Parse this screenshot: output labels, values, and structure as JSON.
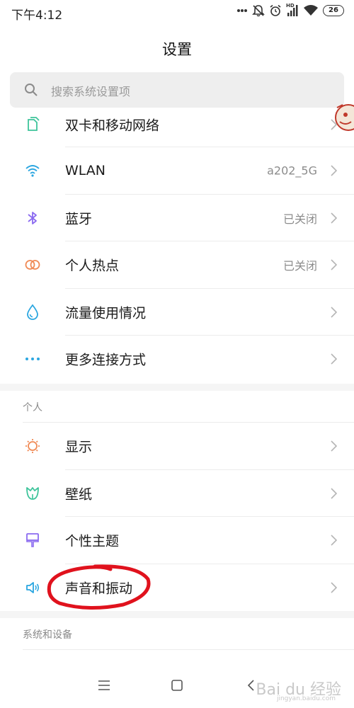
{
  "status_bar": {
    "time": "下午4:12",
    "battery": "26",
    "network_tag": "HD"
  },
  "header": {
    "title": "设置"
  },
  "search": {
    "placeholder": "搜索系统设置项"
  },
  "network_items": [
    {
      "label": "双卡和移动网络",
      "value": "",
      "icon": "sim-card-icon",
      "color": "#3ec49b"
    },
    {
      "label": "WLAN",
      "value": "a202_5G",
      "icon": "wifi-icon",
      "color": "#2aa6e0"
    },
    {
      "label": "蓝牙",
      "value": "已关闭",
      "icon": "bluetooth-icon",
      "color": "#8b6bf0"
    },
    {
      "label": "个人热点",
      "value": "已关闭",
      "icon": "hotspot-icon",
      "color": "#f08a55"
    },
    {
      "label": "流量使用情况",
      "value": "",
      "icon": "data-usage-icon",
      "color": "#2aa6e0"
    },
    {
      "label": "更多连接方式",
      "value": "",
      "icon": "more-dots-icon",
      "color": "#2aa6e0"
    }
  ],
  "personal_section": {
    "header": "个人",
    "items": [
      {
        "label": "显示",
        "icon": "display-icon",
        "color": "#f08a55"
      },
      {
        "label": "壁纸",
        "icon": "wallpaper-icon",
        "color": "#3ec49b"
      },
      {
        "label": "个性主题",
        "icon": "theme-icon",
        "color": "#8b6bf0"
      },
      {
        "label": "声音和振动",
        "icon": "sound-icon",
        "color": "#2aa6e0"
      }
    ]
  },
  "system_section": {
    "header": "系统和设备"
  },
  "nav_bar": {
    "icons": [
      "menu-icon",
      "home-icon",
      "back-icon"
    ]
  },
  "watermark": {
    "brand": "Bai du 经验",
    "url": "jingyan.baidu.com"
  },
  "colors": {
    "annotation": "#e0121d",
    "background": "#ffffff",
    "section_gap": "#f5f5f5"
  }
}
